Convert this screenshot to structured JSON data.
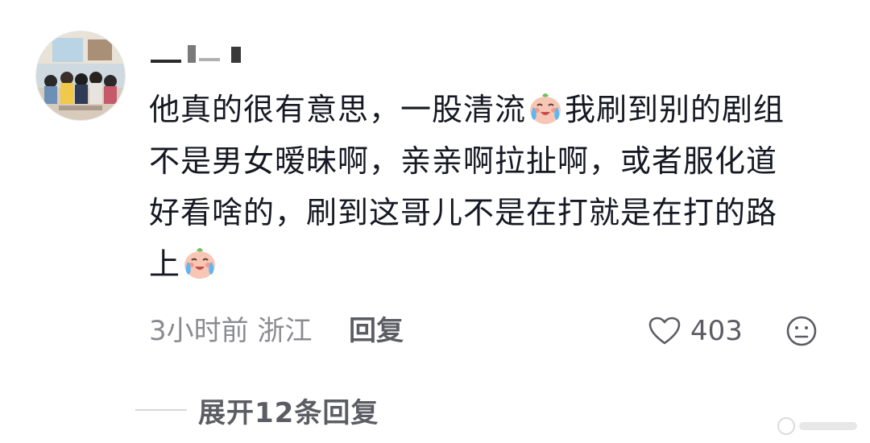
{
  "comment": {
    "username_hidden": true,
    "lines": [
      {
        "before": "他真的很有意思，一股清流",
        "emoji": "cry-laugh-emoji",
        "after": "我刷到别的剧组"
      },
      {
        "before": "不是男女暧昧啊，亲亲啊拉扯啊，或者服化道",
        "emoji": null,
        "after": ""
      },
      {
        "before": "好看啥的，刷到这哥儿不是在打就是在打的路",
        "emoji": null,
        "after": ""
      },
      {
        "before": "上",
        "emoji": "cry-laugh-emoji",
        "after": ""
      }
    ]
  },
  "meta": {
    "time_location": "3小时前 浙江",
    "reply_label": "回复",
    "like_icon": "heart-outline-icon",
    "like_count": "403",
    "dislike_icon": "frown-face-icon"
  },
  "expand": {
    "label": "展开12条回复"
  },
  "colors": {
    "text_primary": "#161823",
    "text_secondary": "#8a8b91",
    "text_action": "#5c5d64"
  }
}
